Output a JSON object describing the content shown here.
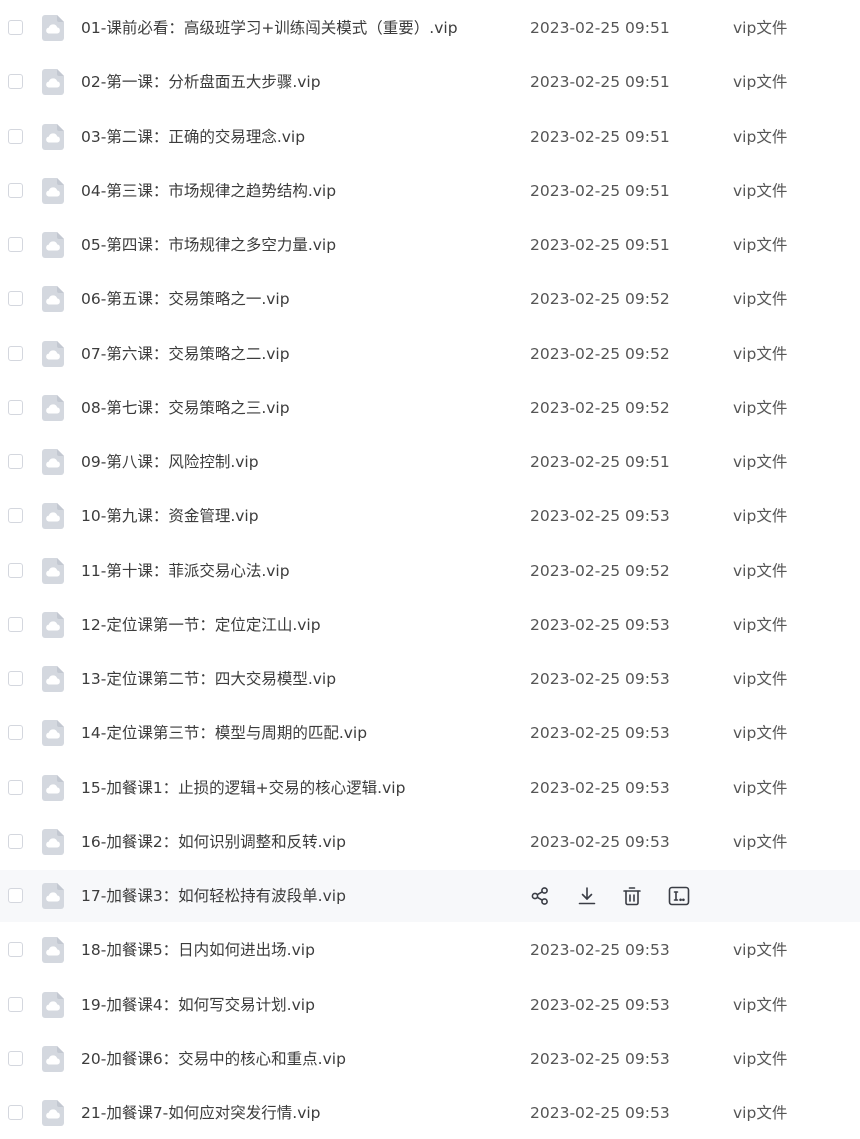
{
  "files": [
    {
      "name": "01-课前必看：高级班学习+训练闯关模式（重要）.vip",
      "date": "2023-02-25 09:51",
      "type": "vip文件"
    },
    {
      "name": "02-第一课：分析盘面五大步骤.vip",
      "date": "2023-02-25 09:51",
      "type": "vip文件"
    },
    {
      "name": "03-第二课：正确的交易理念.vip",
      "date": "2023-02-25 09:51",
      "type": "vip文件"
    },
    {
      "name": "04-第三课：市场规律之趋势结构.vip",
      "date": "2023-02-25 09:51",
      "type": "vip文件"
    },
    {
      "name": "05-第四课：市场规律之多空力量.vip",
      "date": "2023-02-25 09:51",
      "type": "vip文件"
    },
    {
      "name": "06-第五课：交易策略之一.vip",
      "date": "2023-02-25 09:52",
      "type": "vip文件"
    },
    {
      "name": "07-第六课：交易策略之二.vip",
      "date": "2023-02-25 09:52",
      "type": "vip文件"
    },
    {
      "name": "08-第七课：交易策略之三.vip",
      "date": "2023-02-25 09:52",
      "type": "vip文件"
    },
    {
      "name": "09-第八课：风险控制.vip",
      "date": "2023-02-25 09:51",
      "type": "vip文件"
    },
    {
      "name": "10-第九课：资金管理.vip",
      "date": "2023-02-25 09:53",
      "type": "vip文件"
    },
    {
      "name": "11-第十课：菲派交易心法.vip",
      "date": "2023-02-25 09:52",
      "type": "vip文件"
    },
    {
      "name": "12-定位课第一节：定位定江山.vip",
      "date": "2023-02-25 09:53",
      "type": "vip文件"
    },
    {
      "name": "13-定位课第二节：四大交易模型.vip",
      "date": "2023-02-25 09:53",
      "type": "vip文件"
    },
    {
      "name": "14-定位课第三节：模型与周期的匹配.vip",
      "date": "2023-02-25 09:53",
      "type": "vip文件"
    },
    {
      "name": "15-加餐课1：止损的逻辑+交易的核心逻辑.vip",
      "date": "2023-02-25 09:53",
      "type": "vip文件"
    },
    {
      "name": "16-加餐课2：如何识别调整和反转.vip",
      "date": "2023-02-25 09:53",
      "type": "vip文件"
    },
    {
      "name": "17-加餐课3：如何轻松持有波段单.vip",
      "date": "",
      "type": "",
      "hovered": true,
      "actions": [
        "share-icon",
        "download-icon",
        "delete-icon",
        "rename-icon"
      ]
    },
    {
      "name": "18-加餐课5：日内如何进出场.vip",
      "date": "2023-02-25 09:53",
      "type": "vip文件"
    },
    {
      "name": "19-加餐课4：如何写交易计划.vip",
      "date": "2023-02-25 09:53",
      "type": "vip文件"
    },
    {
      "name": "20-加餐课6：交易中的核心和重点.vip",
      "date": "2023-02-25 09:53",
      "type": "vip文件"
    },
    {
      "name": "21-加餐课7-如何应对突发行情.vip",
      "date": "2023-02-25 09:53",
      "type": "vip文件"
    }
  ],
  "colors": {
    "icon": "#d4d8df",
    "icon_cloud": "#ffffff",
    "action": "#3a3d45",
    "hover_bg": "#f7f8fa"
  }
}
